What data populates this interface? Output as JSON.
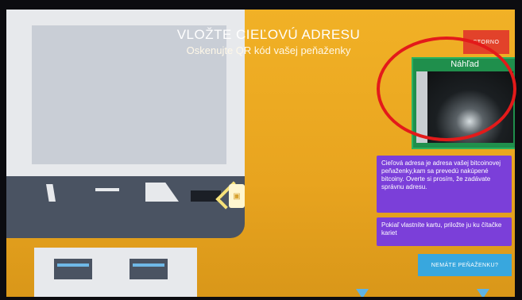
{
  "header": {
    "title": "VLOŽTE CIEĽOVÚ ADRESU",
    "subtitle": "Oskenujte QR kód vašej peňaženky"
  },
  "buttons": {
    "storno": "STORNO",
    "no_wallet": "NEMÁTE PEŇAŽENKU?"
  },
  "preview": {
    "label": "Náhľad"
  },
  "info": {
    "address_notice": "Cieľová adresa je adresa vašej bitcoinovej peňaženky,kam sa prevedú nakúpené bitcoiny. Overte si prosím, že zadávate správnu adresu.",
    "card_notice": "Pokiaľ vlastníte kartu, priložte ju ku čítačke kariet"
  },
  "colors": {
    "background": "#e8a41f",
    "storno": "#e2422a",
    "preview_frame": "#2cb35e",
    "info_box": "#7b3fd9",
    "no_wallet": "#38a7de",
    "highlight": "#e31a1a"
  },
  "icons": [
    "qr-code-icon",
    "arrow-down-icon"
  ]
}
